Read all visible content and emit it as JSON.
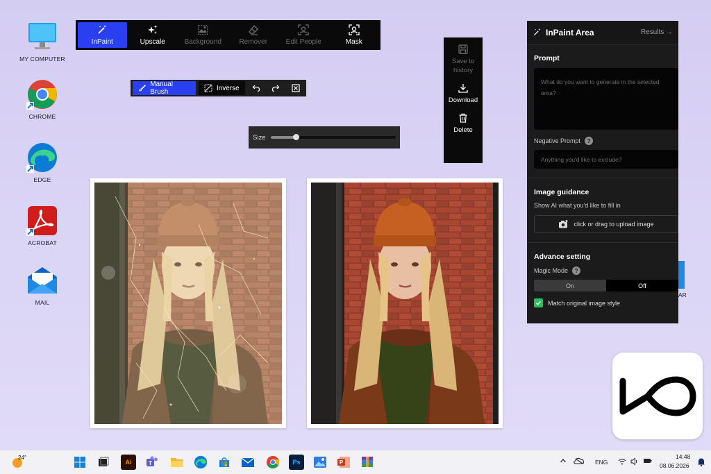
{
  "desktop": {
    "icons": [
      {
        "label": "MY COMPUTER",
        "icon": "monitor-icon"
      },
      {
        "label": "CHROME",
        "icon": "chrome-icon"
      },
      {
        "label": "EDGE",
        "icon": "edge-icon"
      },
      {
        "label": "ACROBAT",
        "icon": "acrobat-icon"
      },
      {
        "label": "MAIL",
        "icon": "mail-icon"
      }
    ],
    "partial_icon_label": "AR"
  },
  "toolbar": {
    "items": [
      {
        "label": "InPaint",
        "state": "active"
      },
      {
        "label": "Upscale",
        "state": "enabled"
      },
      {
        "label": "Background",
        "state": "disabled"
      },
      {
        "label": "Remover",
        "state": "disabled"
      },
      {
        "label": "Edit People",
        "state": "disabled"
      },
      {
        "label": "Mask",
        "state": "enabled"
      }
    ]
  },
  "brushbar": {
    "manual_brush": "Manual Brush",
    "inverse": "Inverse"
  },
  "sizebar": {
    "label": "Size",
    "value_fraction": 0.2
  },
  "actions": {
    "save": "Save to history",
    "download": "Download",
    "delete": "Delete"
  },
  "panel": {
    "title": "InPaint Area",
    "results": "Results →",
    "prompt_title": "Prompt",
    "prompt_placeholder": "What do you want to generate in the selected area?",
    "negative_label": "Negative Prompt",
    "negative_placeholder": "Anything you'd like to exclude?",
    "guidance_title": "Image guidance",
    "guidance_sub": "Show AI what you'd like to fill in",
    "upload_label": "click or drag to upload image",
    "advance_title": "Advance setting",
    "magic_label": "Magic Mode",
    "magic_on": "On",
    "magic_off": "Off",
    "match_label": "Match original image style"
  },
  "taskbar": {
    "weather": "24°",
    "lang": "ENG",
    "time": "14:48",
    "date": "08.06.2026"
  },
  "colors": {
    "accent": "#2a3ff0",
    "panel_bg": "#1b1b1b",
    "check_green": "#25c25a"
  }
}
